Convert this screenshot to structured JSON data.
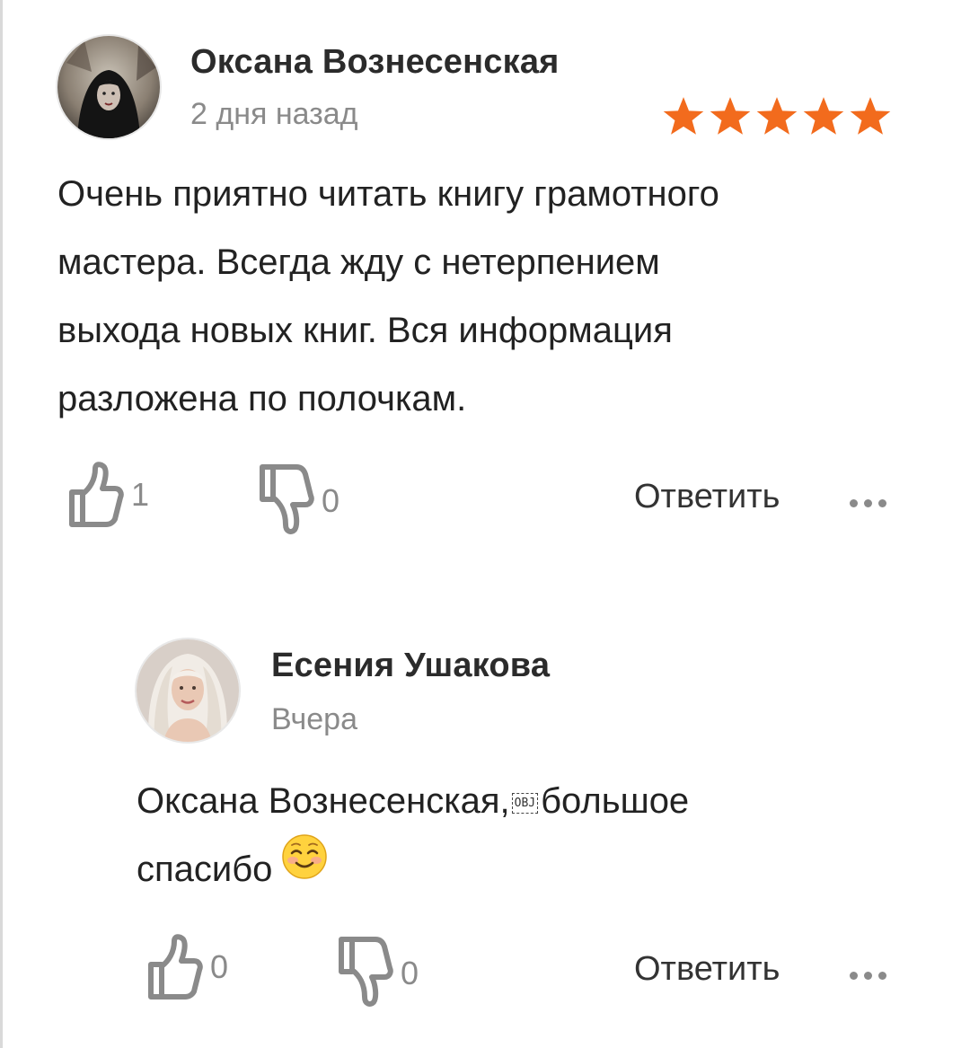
{
  "comments": [
    {
      "author": "Оксана Вознесенская",
      "date": "2 дня назад",
      "rating": 5,
      "star_color": "#f26b1d",
      "text_lines": [
        "Очень приятно читать книгу грамотного",
        "мастера. Всегда жду с нетерпением",
        "выхода новых книг. Вся информация",
        "разложена по полочкам."
      ],
      "likes": "1",
      "dislikes": "0",
      "reply_label": "Ответить",
      "avatar_icon": "avatar-dark-hood"
    },
    {
      "author": "Есения Ушакова",
      "date": "Вчера",
      "text_line1_before": "Оксана Вознесенская,",
      "obj_label": "OBJ",
      "text_line1_after": "большое",
      "text_line2": "спасибо",
      "emoji_icon": "smiling-face-emoji",
      "likes": "0",
      "dislikes": "0",
      "reply_label": "Ответить",
      "avatar_icon": "avatar-blonde"
    }
  ],
  "icons": {
    "like": "thumbs-up-icon",
    "dislike": "thumbs-down-icon",
    "more": "more-dots-icon"
  },
  "colors": {
    "accent_star": "#f26b1d",
    "muted": "#8a8a8a"
  }
}
